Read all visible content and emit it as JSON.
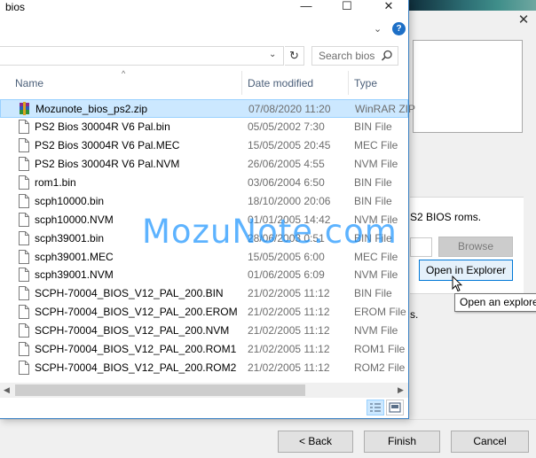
{
  "background_dialog": {
    "roms_text": "S2 BIOS roms.",
    "browse_label": "Browse",
    "open_explorer_label": "Open in Explorer",
    "tooltip": "Open an explorer",
    "truncated_text": "s.",
    "close_glyph": "✕",
    "footer": {
      "back": "< Back",
      "finish": "Finish",
      "cancel": "Cancel"
    }
  },
  "file_dialog": {
    "title": "bios",
    "window_buttons": {
      "minimize": "—",
      "maximize": "☐",
      "close": "✕"
    },
    "search_placeholder": "Search bios",
    "help_glyph": "?",
    "columns": {
      "name": "Name",
      "date": "Date modified",
      "type": "Type"
    },
    "files": [
      {
        "name": "Mozunote_bios_ps2.zip",
        "date": "07/08/2020 11:20",
        "type": "WinRAR ZIP",
        "icon": "winrar-archive-icon",
        "selected": true
      },
      {
        "name": "PS2 Bios 30004R V6 Pal.bin",
        "date": "05/05/2002 7:30",
        "type": "BIN File",
        "icon": "file-icon"
      },
      {
        "name": "PS2 Bios 30004R V6 Pal.MEC",
        "date": "15/05/2005 20:45",
        "type": "MEC File",
        "icon": "file-icon"
      },
      {
        "name": "PS2 Bios 30004R V6 Pal.NVM",
        "date": "26/06/2005 4:55",
        "type": "NVM File",
        "icon": "file-icon"
      },
      {
        "name": "rom1.bin",
        "date": "03/06/2004 6:50",
        "type": "BIN File",
        "icon": "file-icon"
      },
      {
        "name": "scph10000.bin",
        "date": "18/10/2000 20:06",
        "type": "BIN File",
        "icon": "file-icon"
      },
      {
        "name": "scph10000.NVM",
        "date": "01/01/2005 14:42",
        "type": "NVM File",
        "icon": "file-icon"
      },
      {
        "name": "scph39001.bin",
        "date": "28/06/2003 0:51",
        "type": "BIN File",
        "icon": "file-icon"
      },
      {
        "name": "scph39001.MEC",
        "date": "15/05/2005 6:00",
        "type": "MEC File",
        "icon": "file-icon"
      },
      {
        "name": "scph39001.NVM",
        "date": "01/06/2005 6:09",
        "type": "NVM File",
        "icon": "file-icon"
      },
      {
        "name": "SCPH-70004_BIOS_V12_PAL_200.BIN",
        "date": "21/02/2005 11:12",
        "type": "BIN File",
        "icon": "file-icon"
      },
      {
        "name": "SCPH-70004_BIOS_V12_PAL_200.EROM",
        "date": "21/02/2005 11:12",
        "type": "EROM File",
        "icon": "file-icon"
      },
      {
        "name": "SCPH-70004_BIOS_V12_PAL_200.NVM",
        "date": "21/02/2005 11:12",
        "type": "NVM File",
        "icon": "file-icon"
      },
      {
        "name": "SCPH-70004_BIOS_V12_PAL_200.ROM1",
        "date": "21/02/2005 11:12",
        "type": "ROM1 File",
        "icon": "file-icon"
      },
      {
        "name": "SCPH-70004_BIOS_V12_PAL_200.ROM2",
        "date": "21/02/2005 11:12",
        "type": "ROM2 File",
        "icon": "file-icon"
      }
    ]
  },
  "watermark": "MozuNote.com",
  "colors": {
    "accent": "#0078d7",
    "selection": "#cce8ff",
    "header_text": "#4c607a",
    "watermark": "#1e96ff"
  }
}
